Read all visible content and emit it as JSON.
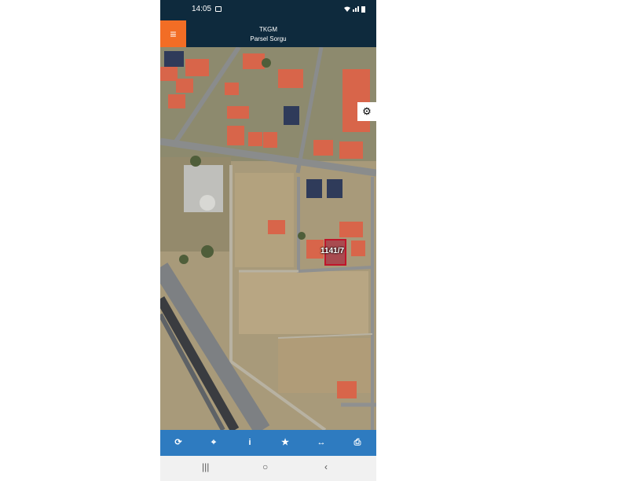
{
  "status_bar": {
    "time": "14:05",
    "icons": "wifi-icon signal-icon battery-icon"
  },
  "header": {
    "menu_icon": "≡",
    "title": "TKGM",
    "subtitle": "Parsel Sorgu"
  },
  "map": {
    "settings_icon": "⚙",
    "parcel_label": "1141/7"
  },
  "toolbar": {
    "refresh_icon": "⟳",
    "locate_icon": "⌖",
    "info_icon": "i",
    "favorite_icon": "★",
    "measure_icon": "↔",
    "print_icon": "⎙"
  },
  "nav_bar": {
    "recents_icon": "|||",
    "home_icon": "○",
    "back_icon": "‹"
  },
  "colors": {
    "header_bg": "#0e2a3d",
    "menu_bg": "#f26d25",
    "toolbar_bg": "#2e7bc0",
    "parcel_outline": "#c0152a"
  }
}
